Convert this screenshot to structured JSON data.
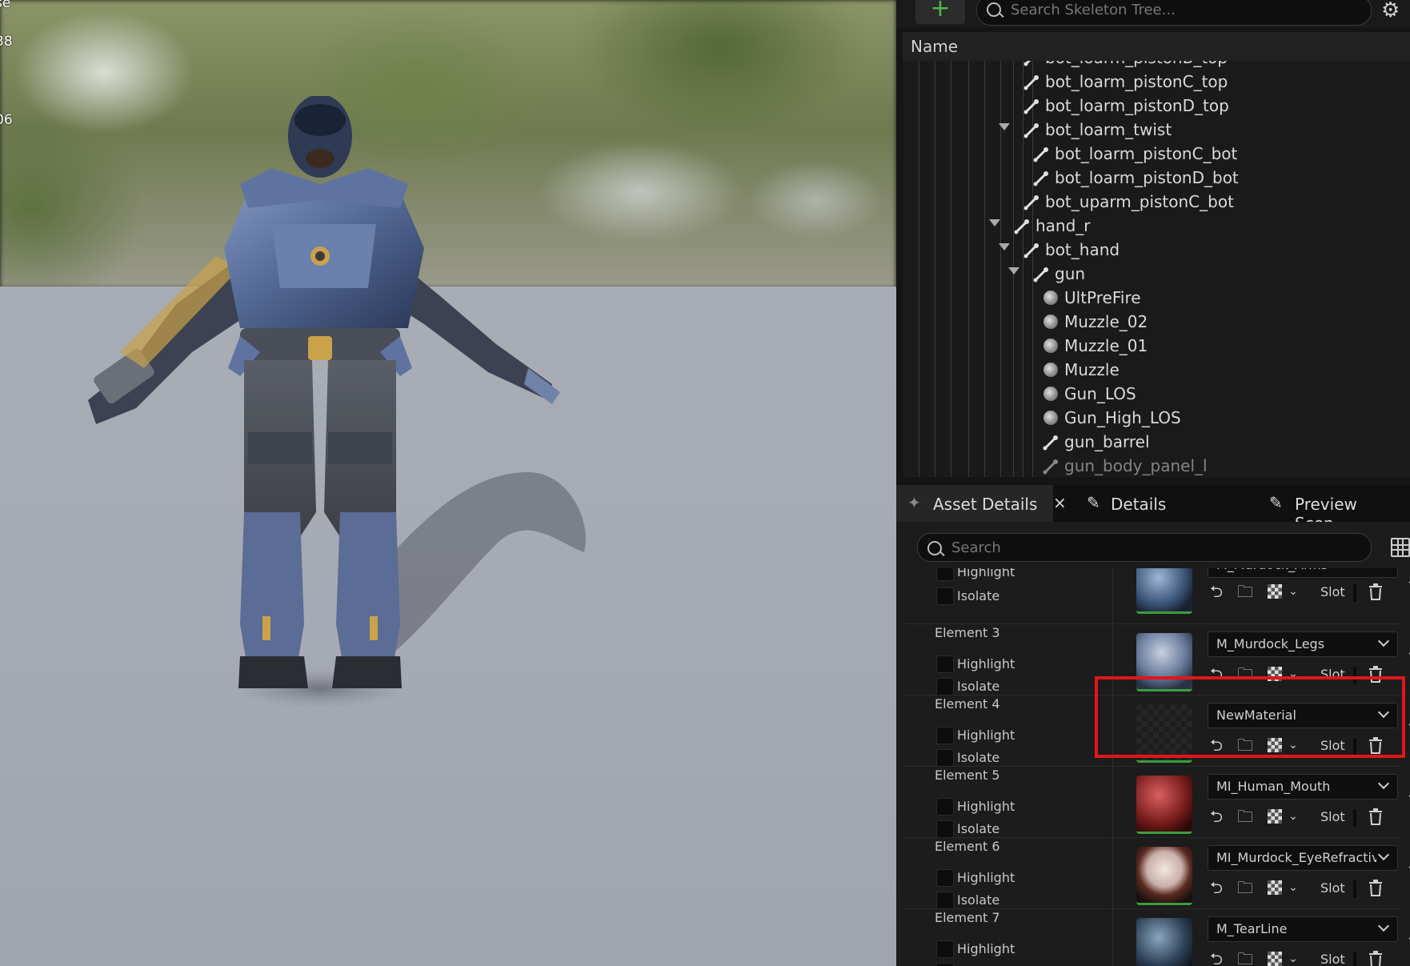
{
  "viewport": {
    "overlay_lines": [
      "se",
      "38",
      "06"
    ]
  },
  "skeleton_tree": {
    "add_label": "+",
    "search_placeholder": "Search Skeleton Tree...",
    "column_header": "Name",
    "rows": [
      {
        "label": "bot_loarm_pistonB_top",
        "type": "bone",
        "expanded": false
      },
      {
        "label": "bot_loarm_pistonC_top",
        "type": "bone",
        "expanded": false
      },
      {
        "label": "bot_loarm_pistonD_top",
        "type": "bone",
        "expanded": false
      },
      {
        "label": "bot_loarm_twist",
        "type": "bone",
        "expanded": true
      },
      {
        "label": "bot_loarm_pistonC_bot",
        "type": "bone",
        "expanded": false
      },
      {
        "label": "bot_loarm_pistonD_bot",
        "type": "bone",
        "expanded": false
      },
      {
        "label": "bot_uparm_pistonC_bot",
        "type": "bone",
        "expanded": false
      },
      {
        "label": "hand_r",
        "type": "bone",
        "expanded": true
      },
      {
        "label": "bot_hand",
        "type": "bone",
        "expanded": true
      },
      {
        "label": "gun",
        "type": "bone",
        "expanded": true
      },
      {
        "label": "UltPreFire",
        "type": "socket",
        "expanded": false
      },
      {
        "label": "Muzzle_02",
        "type": "socket",
        "expanded": false
      },
      {
        "label": "Muzzle_01",
        "type": "socket",
        "expanded": false
      },
      {
        "label": "Muzzle",
        "type": "socket",
        "expanded": false
      },
      {
        "label": "Gun_LOS",
        "type": "socket",
        "expanded": false
      },
      {
        "label": "Gun_High_LOS",
        "type": "socket",
        "expanded": false
      },
      {
        "label": "gun_barrel",
        "type": "bone",
        "expanded": false
      },
      {
        "label": "gun_body_panel_l",
        "type": "bone",
        "expanded": false
      }
    ]
  },
  "tabs": [
    {
      "label": "Asset Details",
      "icon": "asset-icon",
      "active": true,
      "close": "×"
    },
    {
      "label": "Details",
      "icon": "pencil-icon",
      "active": false
    },
    {
      "label": "Preview Scen...",
      "icon": "pencil-icon",
      "active": false
    }
  ],
  "asset_details": {
    "search_placeholder": "Search",
    "highlight_label": "Highlight",
    "isolate_label": "Isolate",
    "slot_label": "Slot",
    "elements": [
      {
        "name": "",
        "material": "M_Murdock_Arms",
        "thumb": "blue-globe"
      },
      {
        "name": "Element 3",
        "material": "M_Murdock_Legs",
        "thumb": "blue-metal"
      },
      {
        "name": "Element 4",
        "material": "NewMaterial",
        "thumb": "empty"
      },
      {
        "name": "Element 5",
        "material": "MI_Human_Mouth",
        "thumb": "red"
      },
      {
        "name": "Element 6",
        "material": "MI_Murdock_EyeRefractive",
        "thumb": "eye"
      },
      {
        "name": "Element 7",
        "material": "M_TearLine",
        "thumb": "dark-globe"
      }
    ]
  },
  "colors": {
    "accent_red": "#e0161a",
    "add_green": "#4fb84a",
    "panel_bg": "#1c1c1c"
  }
}
